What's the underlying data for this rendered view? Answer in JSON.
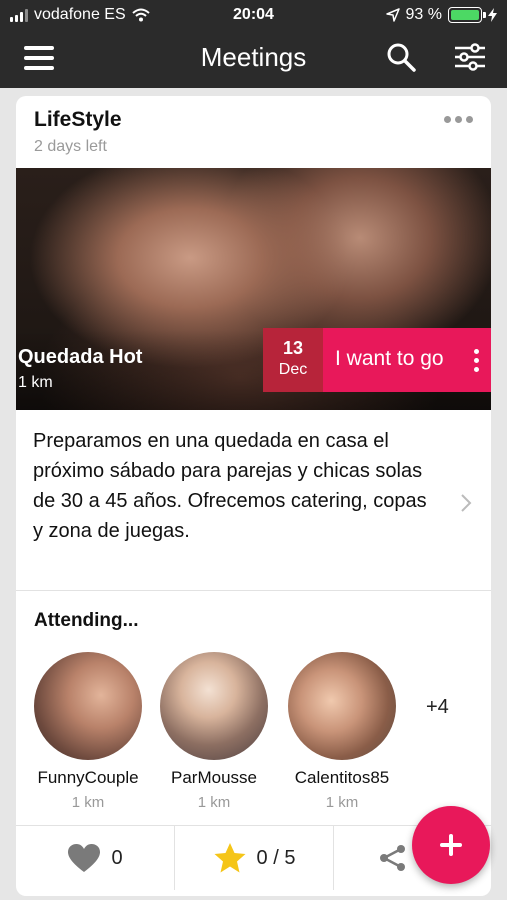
{
  "status_bar": {
    "carrier": "vodafone ES",
    "time": "20:04",
    "battery": "93 %",
    "icons": [
      "signal-icon",
      "wifi-icon",
      "location-arrow-icon",
      "battery-icon",
      "charging-bolt-icon"
    ]
  },
  "header": {
    "title": "Meetings",
    "icons": [
      "menu-icon",
      "search-icon",
      "filter-sliders-icon"
    ]
  },
  "meeting": {
    "category": "LifeStyle",
    "time_left": "2 days left",
    "name": "Quedada Hot",
    "distance": "1 km",
    "date_day": "13",
    "date_month": "Dec",
    "cta_label": "I want to go",
    "description": "Preparamos en una quedada en casa el próximo sábado para parejas y chicas solas de 30 a 45 años. Ofrecemos catering, copas y zona de juegas."
  },
  "attending": {
    "title": "Attending...",
    "people": [
      {
        "name": "FunnyCouple",
        "distance": "1 km"
      },
      {
        "name": "ParMousse",
        "distance": "1 km"
      },
      {
        "name": "Calentitos85",
        "distance": "1 km"
      }
    ],
    "more": "+4"
  },
  "footer": {
    "likes": "0",
    "rating": "0 / 5",
    "icons": [
      "heart-icon",
      "star-icon",
      "share-icon"
    ]
  },
  "colors": {
    "accent": "#e8185a",
    "date_bg": "#b7243a",
    "header_bg": "#2b2b2b",
    "star": "#f5c518"
  }
}
